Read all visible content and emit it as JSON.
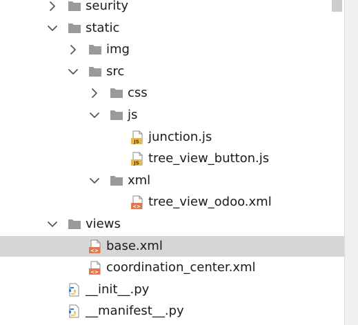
{
  "colors": {
    "folder": "#9a9a9a",
    "chevron": "#555555",
    "selection": "#d6d6d6",
    "js_badge": "#e8b84b",
    "xml_badge": "#e2764f",
    "py_blue": "#3f79b5",
    "py_yellow": "#f5c83a"
  },
  "tree": {
    "items": [
      {
        "label": "seurity",
        "type": "folder",
        "expanded": false,
        "depth": 1,
        "icon": "folder-icon"
      },
      {
        "label": "static",
        "type": "folder",
        "expanded": true,
        "depth": 1,
        "icon": "folder-icon"
      },
      {
        "label": "img",
        "type": "folder",
        "expanded": false,
        "depth": 2,
        "icon": "folder-icon"
      },
      {
        "label": "src",
        "type": "folder",
        "expanded": true,
        "depth": 2,
        "icon": "folder-icon"
      },
      {
        "label": "css",
        "type": "folder",
        "expanded": false,
        "depth": 3,
        "icon": "folder-icon"
      },
      {
        "label": "js",
        "type": "folder",
        "expanded": true,
        "depth": 3,
        "icon": "folder-icon"
      },
      {
        "label": "junction.js",
        "type": "file",
        "depth": 4,
        "icon": "js-file-icon",
        "badge": "JS"
      },
      {
        "label": "tree_view_button.js",
        "type": "file",
        "depth": 4,
        "icon": "js-file-icon",
        "badge": "JS"
      },
      {
        "label": "xml",
        "type": "folder",
        "expanded": true,
        "depth": 3,
        "icon": "folder-icon"
      },
      {
        "label": "tree_view_odoo.xml",
        "type": "file",
        "depth": 4,
        "icon": "xml-file-icon",
        "badge": "<>"
      },
      {
        "label": "views",
        "type": "folder",
        "expanded": true,
        "depth": 1,
        "icon": "folder-icon"
      },
      {
        "label": "base.xml",
        "type": "file",
        "depth": 2,
        "icon": "xml-file-icon",
        "badge": "<>",
        "selected": true
      },
      {
        "label": "coordination_center.xml",
        "type": "file",
        "depth": 2,
        "icon": "xml-file-icon",
        "badge": "<>"
      },
      {
        "label": "__init__.py",
        "type": "file",
        "depth": 1,
        "icon": "python-file-icon"
      },
      {
        "label": "__manifest__.py",
        "type": "file",
        "depth": 1,
        "icon": "python-file-icon"
      }
    ]
  }
}
